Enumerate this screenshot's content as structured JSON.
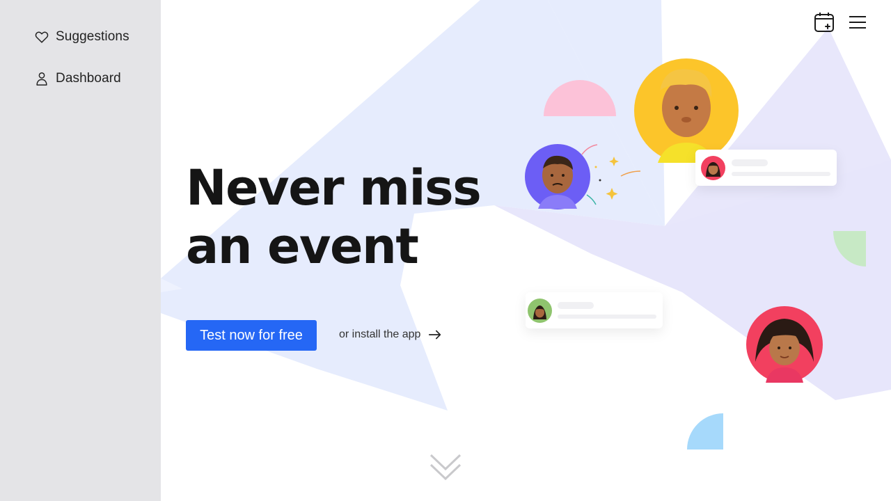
{
  "sidebar": {
    "items": [
      {
        "label": "Suggestions",
        "icon": "heart-icon"
      },
      {
        "label": "Dashboard",
        "icon": "user-icon"
      }
    ]
  },
  "header": {
    "calendar_icon": "calendar-add-icon",
    "menu_icon": "hamburger-menu-icon"
  },
  "hero": {
    "headline_line1": "Never miss",
    "headline_line2": "an event",
    "cta_label": "Test now for free",
    "install_label": "or install the app"
  },
  "colors": {
    "accent": "#2567f5",
    "sidebar_bg": "#e4e4e7",
    "shape_blue": "#e6ecfd",
    "shape_purple": "#e7e6fb",
    "avatar_yellow": "#fcc52a",
    "avatar_purple": "#6c5ef5",
    "avatar_red": "#f2405f",
    "avatar_green": "#8fc46e",
    "accent_pink": "#fcc2d8",
    "accent_green": "#c7e9c5",
    "accent_lightblue": "#a6d9fb"
  }
}
